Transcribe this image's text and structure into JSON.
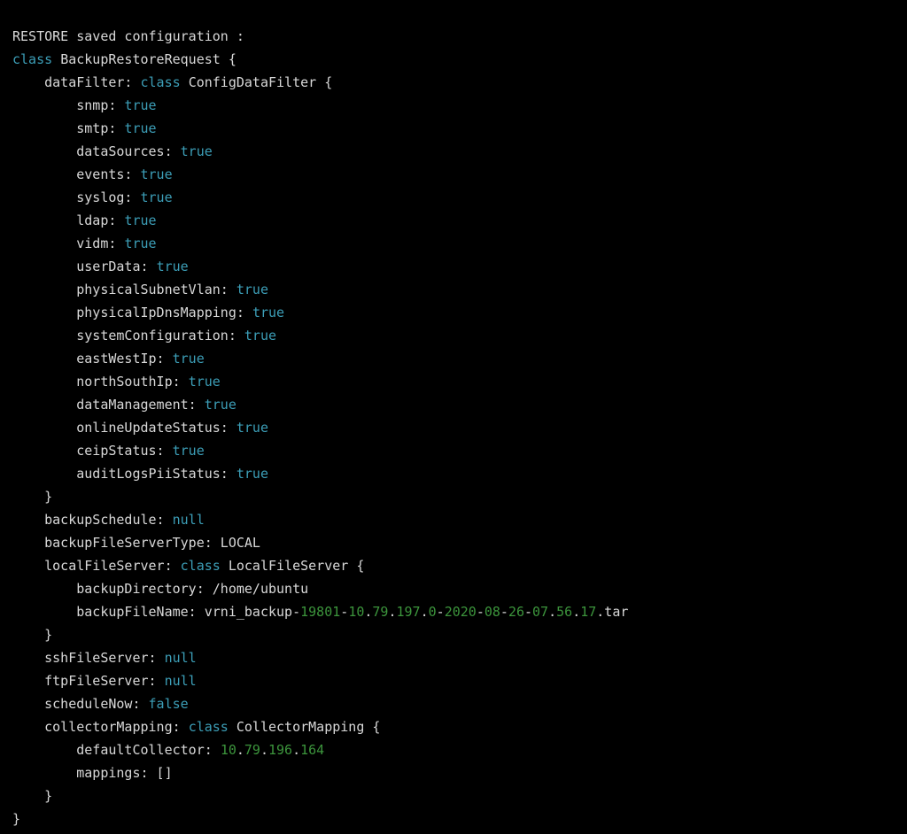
{
  "header": "RESTORE saved configuration :",
  "classKw": "class",
  "mainClass": "BackupRestoreRequest",
  "dataFilterLabel": "dataFilter:",
  "configDataFilterClass": "ConfigDataFilter",
  "filters": {
    "snmp": "true",
    "smtp": "true",
    "dataSources": "true",
    "events": "true",
    "syslog": "true",
    "ldap": "true",
    "vidm": "true",
    "userData": "true",
    "physicalSubnetVlan": "true",
    "physicalIpDnsMapping": "true",
    "systemConfiguration": "true",
    "eastWestIp": "true",
    "northSouthIp": "true",
    "dataManagement": "true",
    "onlineUpdateStatus": "true",
    "ceipStatus": "true",
    "auditLogsPiiStatus": "true"
  },
  "filterFieldLabels": {
    "snmp": "snmp:",
    "smtp": "smtp:",
    "dataSources": "dataSources:",
    "events": "events:",
    "syslog": "syslog:",
    "ldap": "ldap:",
    "vidm": "vidm:",
    "userData": "userData:",
    "physicalSubnetVlan": "physicalSubnetVlan:",
    "physicalIpDnsMapping": "physicalIpDnsMapping:",
    "systemConfiguration": "systemConfiguration:",
    "eastWestIp": "eastWestIp:",
    "northSouthIp": "northSouthIp:",
    "dataManagement": "dataManagement:",
    "onlineUpdateStatus": "onlineUpdateStatus:",
    "ceipStatus": "ceipStatus:",
    "auditLogsPiiStatus": "auditLogsPiiStatus:"
  },
  "backupScheduleLabel": "backupSchedule:",
  "backupScheduleValue": "null",
  "backupFileServerTypeLabel": "backupFileServerType: LOCAL",
  "localFileServerLabel": "localFileServer:",
  "localFileServerClass": "LocalFileServer",
  "backupDirectoryLine": "backupDirectory: /home/ubuntu",
  "backupFileNamePrefix": "backupFileName: vrni_backup-",
  "bfParts": {
    "p1": "19801",
    "p2": "10",
    "p3": "79",
    "p4": "197",
    "p5": "0",
    "p6": "2020",
    "p7": "08",
    "p8": "26",
    "p9": "07",
    "p10": "56",
    "p11": "17",
    "ext": ".tar"
  },
  "sshFileServerLabel": "sshFileServer:",
  "sshFileServerValue": "null",
  "ftpFileServerLabel": "ftpFileServer:",
  "ftpFileServerValue": "null",
  "scheduleNowLabel": "scheduleNow:",
  "scheduleNowValue": "false",
  "collectorMappingLabel": "collectorMapping:",
  "collectorMappingClass": "CollectorMapping",
  "defaultCollectorLabel": "defaultCollector:",
  "dcParts": {
    "a": "10",
    "b": "79",
    "c": "196",
    "d": "164"
  },
  "mappingsLine": "mappings: []",
  "dash": "-",
  "dot": ".",
  "sp": " ",
  "lbrace": "{",
  "rbrace": "}"
}
